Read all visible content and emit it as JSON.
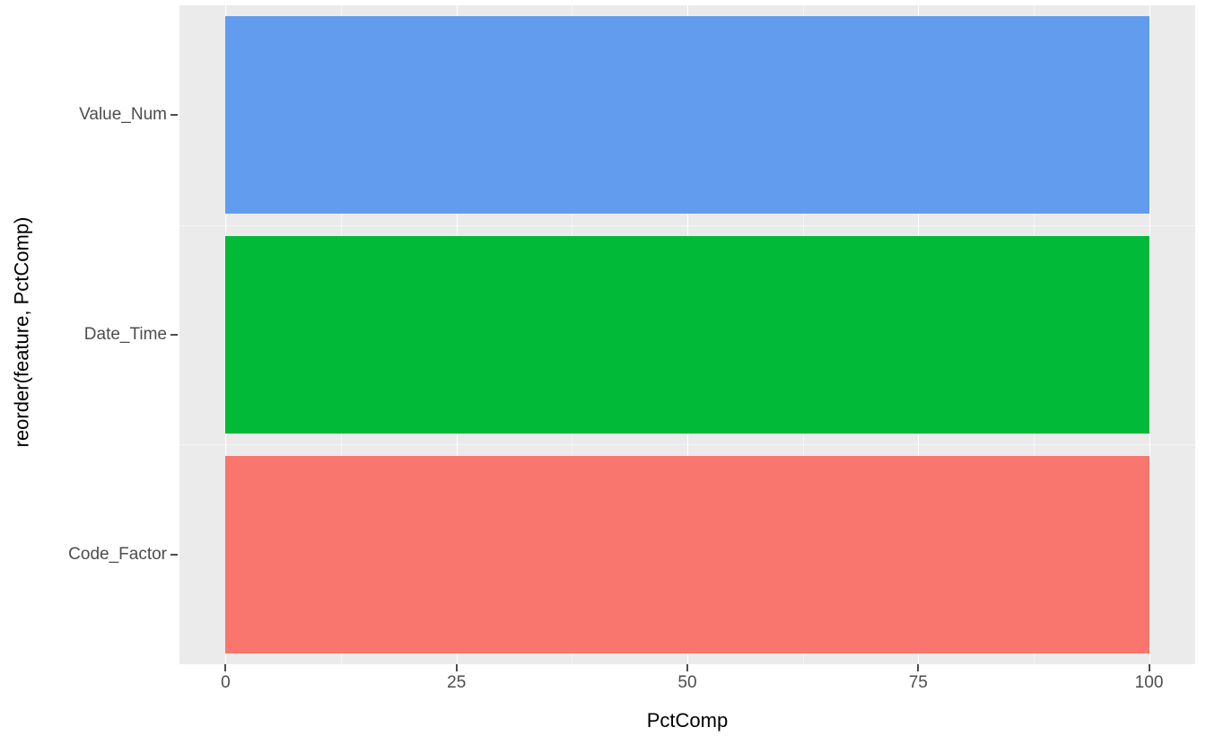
{
  "chart_data": {
    "type": "bar",
    "orientation": "horizontal",
    "categories": [
      "Value_Num",
      "Date_Time",
      "Code_Factor"
    ],
    "values": [
      100,
      100,
      100
    ],
    "colors": [
      "#619cee",
      "#00ba38",
      "#f8766d"
    ],
    "xlabel": "PctComp",
    "ylabel": "reorder(feature, PctComp)",
    "xlim": [
      -5,
      105
    ],
    "x_ticks": [
      0,
      25,
      50,
      75,
      100
    ],
    "x_tick_labels": [
      "0",
      "25",
      "50",
      "75",
      "100"
    ],
    "x_minor_ticks": [
      12.5,
      37.5,
      62.5,
      87.5
    ]
  }
}
